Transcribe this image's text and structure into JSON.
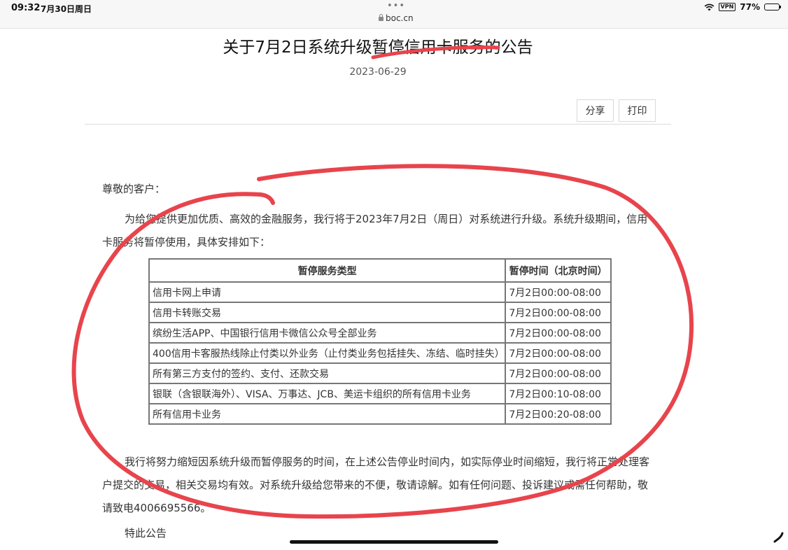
{
  "status_bar": {
    "time": "09:32",
    "date": "7月30日周日",
    "dots": "•••",
    "url": "boc.cn",
    "vpn": "VPN",
    "battery": "77%",
    "battery_level": 0.77
  },
  "article": {
    "title": "关于7月2日系统升级暂停信用卡服务的公告",
    "date": "2023-06-29",
    "share_label": "分享",
    "print_label": "打印",
    "greeting": "尊敬的客户：",
    "intro": "为给您提供更加优质、高效的金融服务，我行将于2023年7月2日（周日）对系统进行升级。系统升级期间，信用卡服务将暂停使用，具体安排如下：",
    "closing": "我行将努力缩短因系统升级而暂停服务的时间，在上述公告停业时间内，如实际停业时间缩短，我行将正常处理客户提交的交易，相关交易均有效。对系统升级给您带来的不便，敬请谅解。如有任何问题、投诉建议或需任何帮助，敬请致电4006695566。",
    "end": "特此公告"
  },
  "table": {
    "headers": [
      "暂停服务类型",
      "暂停时间（北京时间）"
    ],
    "rows": [
      [
        "信用卡网上申请",
        "7月2日00:00-08:00"
      ],
      [
        "信用卡转账交易",
        "7月2日00:00-08:00"
      ],
      [
        "缤纷生活APP、中国银行信用卡微信公众号全部业务",
        "7月2日00:00-08:00"
      ],
      [
        "400信用卡客服热线除止付类以外业务（止付类业务包括挂失、冻结、临时挂失）",
        "7月2日00:00-08:00"
      ],
      [
        "所有第三方支付的签约、支付、还款交易",
        "7月2日00:00-08:00"
      ],
      [
        "银联（含银联海外）、VISA、万事达、JCB、美运卡组织的所有信用卡业务",
        "7月2日00:10-08:00"
      ],
      [
        "所有信用卡业务",
        "7月2日00:20-08:00"
      ]
    ]
  },
  "colors": {
    "annotation_red": "#e8444c",
    "text": "#333333",
    "border": "#777777"
  }
}
